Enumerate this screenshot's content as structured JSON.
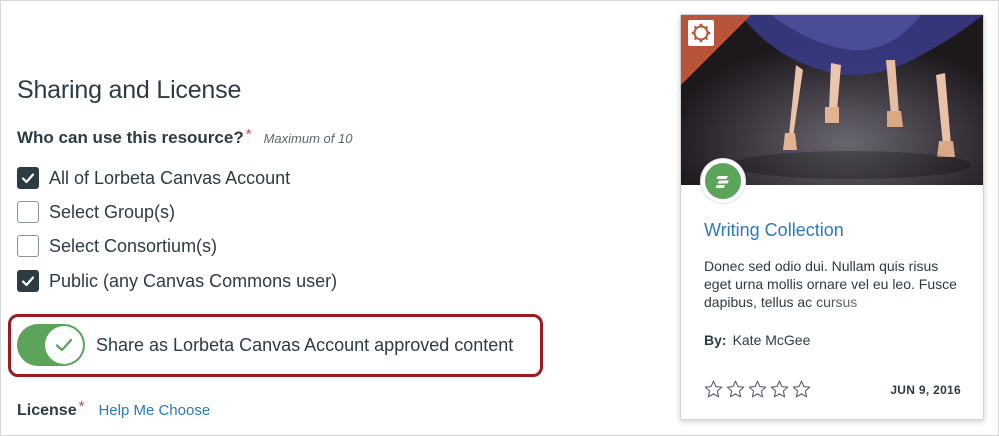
{
  "sharing": {
    "title": "Sharing and License",
    "who_label": "Who can use this resource?",
    "required_mark": "*",
    "max_note": "Maximum of 10",
    "options": [
      {
        "label": "All of Lorbeta Canvas Account",
        "checked": true
      },
      {
        "label": "Select Group(s)",
        "checked": false
      },
      {
        "label": "Select Consortium(s)",
        "checked": false
      },
      {
        "label": "Public (any Canvas Commons user)",
        "checked": true
      }
    ],
    "share_approved_label": "Share as Lorbeta Canvas Account approved content",
    "share_approved_on": true,
    "license_label": "License",
    "license_required_mark": "*",
    "help_link": "Help Me Choose"
  },
  "card": {
    "title": "Writing Collection",
    "description": "Donec sed odio dui. Nullam quis risus eget urna mollis ornare vel eu leo. Fusce dapibus, tellus ac cursus",
    "by_label": "By:",
    "author": "Kate McGee",
    "date": "JUN 9, 2016",
    "rating": 0,
    "rating_max": 5,
    "type_icon": "document-icon",
    "accent_color": "#5ba45a",
    "corner_color": "#b7543a"
  },
  "colors": {
    "link": "#2b7abc",
    "highlight_border": "#9a1b20",
    "required": "#e0412b"
  }
}
